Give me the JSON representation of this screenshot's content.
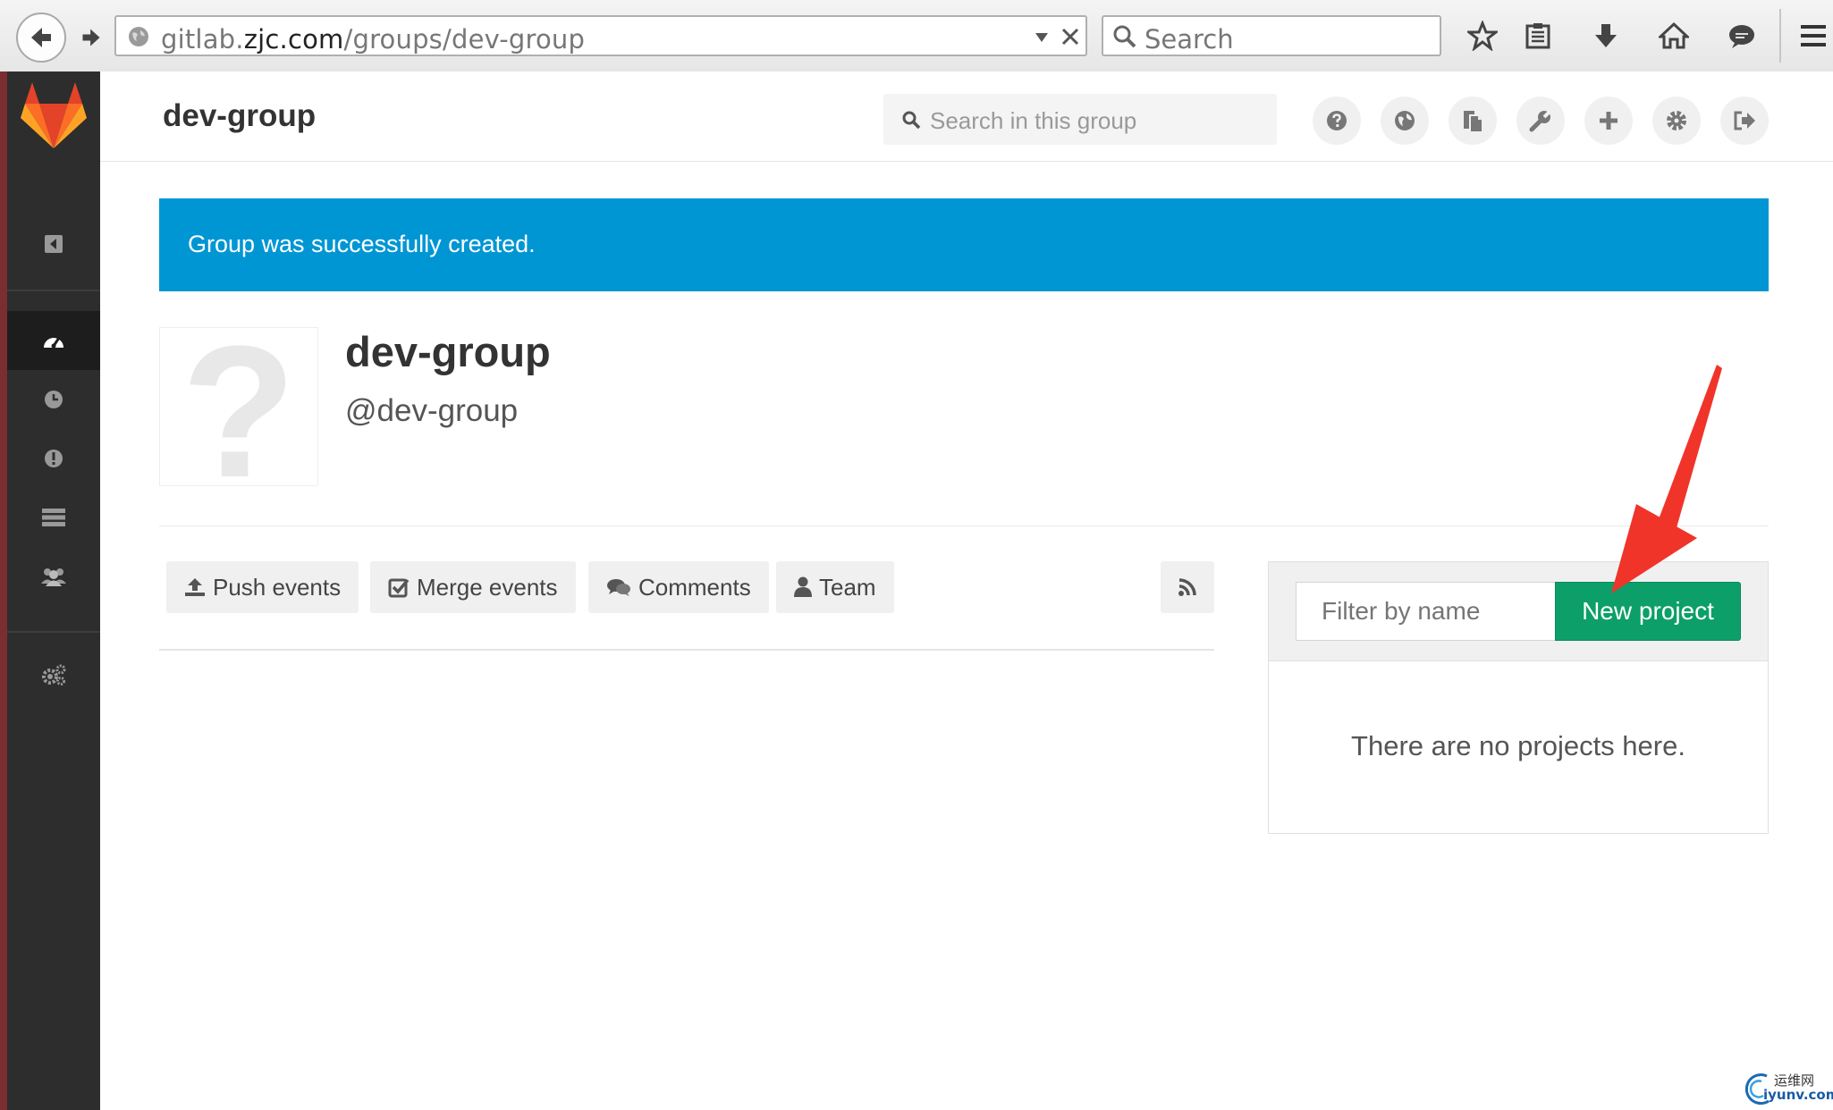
{
  "browser": {
    "url_prefix": "gitlab.",
    "url_host": "zjc.com",
    "url_path": "/groups/dev-group",
    "search_placeholder": "Search"
  },
  "header": {
    "title": "dev-group",
    "search_placeholder": "Search in this group"
  },
  "flash": {
    "message": "Group was successfully created."
  },
  "group": {
    "avatar_placeholder": "?",
    "name": "dev-group",
    "path": "@dev-group"
  },
  "events": {
    "push": "Push events",
    "merge": "Merge events",
    "comments": "Comments",
    "team": "Team"
  },
  "projects": {
    "filter_placeholder": "Filter by name",
    "new_project_label": "New project",
    "empty_message": "There are no projects here."
  },
  "watermark": {
    "cn": "运维网",
    "en": "iyunv.com"
  },
  "colors": {
    "flash": "#0096d4",
    "new_project": "#0c9f6a",
    "sidebar": "#2d2d2d",
    "arrow": "#f0342a"
  }
}
